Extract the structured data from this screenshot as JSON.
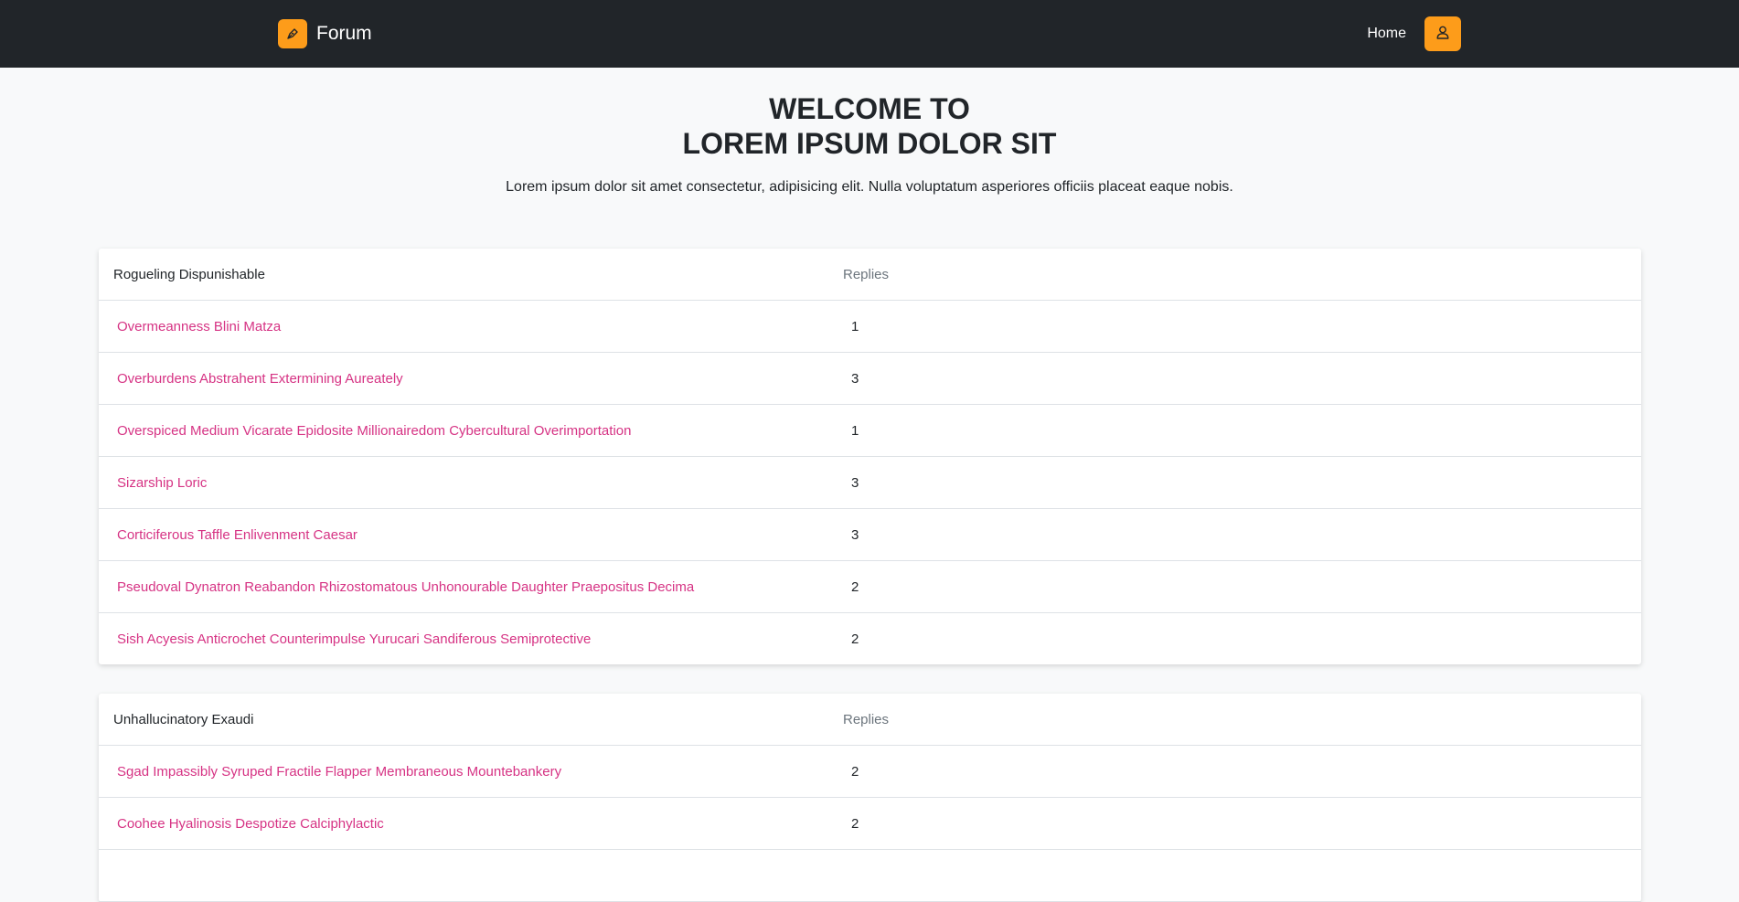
{
  "nav": {
    "brand": "Forum",
    "home_label": "Home"
  },
  "hero": {
    "title_line1": "WELCOME TO",
    "title_line2": "LOREM IPSUM DOLOR SIT",
    "lead": "Lorem ipsum dolor sit amet consectetur, adipisicing elit. Nulla voluptatum asperiores officiis placeat eaque nobis."
  },
  "boards": [
    {
      "name": "Rogueling Dispunishable",
      "replies_header": "Replies",
      "topics": [
        {
          "title": "Overmeanness Blini Matza",
          "replies": "1"
        },
        {
          "title": "Overburdens Abstrahent Extermining Aureately",
          "replies": "3"
        },
        {
          "title": "Overspiced Medium Vicarate Epidosite Millionairedom Cybercultural Overimportation",
          "replies": "1"
        },
        {
          "title": "Sizarship Loric",
          "replies": "3"
        },
        {
          "title": "Corticiferous Taffle Enlivenment Caesar",
          "replies": "3"
        },
        {
          "title": "Pseudoval Dynatron Reabandon Rhizostomatous Unhonourable Daughter Praepositus Decima",
          "replies": "2"
        },
        {
          "title": "Sish Acyesis Anticrochet Counterimpulse Yurucari Sandiferous Semiprotective",
          "replies": "2"
        }
      ]
    },
    {
      "name": "Unhallucinatory Exaudi",
      "replies_header": "Replies",
      "topics": [
        {
          "title": "Sgad Impassibly Syruped Fractile Flapper Membraneous Mountebankery",
          "replies": "2"
        },
        {
          "title": "Coohee Hyalinosis Despotize Calciphylactic",
          "replies": "2"
        },
        {
          "title": "",
          "replies": ""
        }
      ]
    }
  ],
  "colors": {
    "navbar_bg": "#212529",
    "accent": "#fd9c1a",
    "link": "#d63384",
    "page_bg": "#f8f9fa"
  },
  "icons": {
    "brand": "pen-nib-icon",
    "user": "user-icon"
  }
}
